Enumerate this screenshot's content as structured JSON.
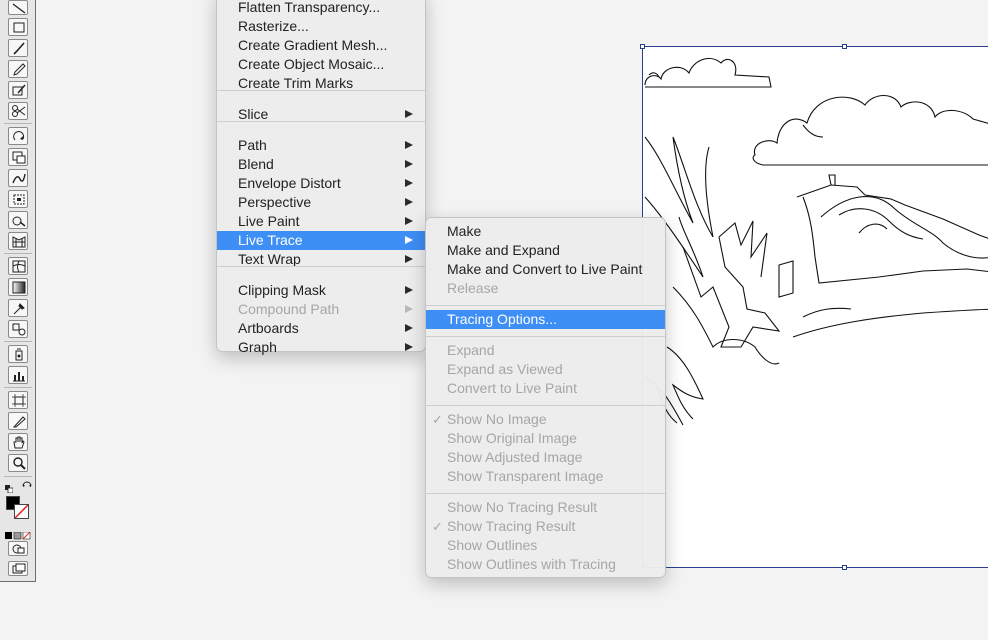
{
  "main_menu": {
    "items": [
      {
        "label": "Flatten Transparency...",
        "enabled": true,
        "submenu": false
      },
      {
        "label": "Rasterize...",
        "enabled": true,
        "submenu": false
      },
      {
        "label": "Create Gradient Mesh...",
        "enabled": true,
        "submenu": false
      },
      {
        "label": "Create Object Mosaic...",
        "enabled": true,
        "submenu": false
      },
      {
        "label": "Create Trim Marks",
        "enabled": true,
        "submenu": false
      },
      {
        "label": "Slice",
        "enabled": true,
        "submenu": true
      },
      {
        "label": "Path",
        "enabled": true,
        "submenu": true
      },
      {
        "label": "Blend",
        "enabled": true,
        "submenu": true
      },
      {
        "label": "Envelope Distort",
        "enabled": true,
        "submenu": true
      },
      {
        "label": "Perspective",
        "enabled": true,
        "submenu": true
      },
      {
        "label": "Live Paint",
        "enabled": true,
        "submenu": true
      },
      {
        "label": "Live Trace",
        "enabled": true,
        "submenu": true,
        "highlighted": true
      },
      {
        "label": "Text Wrap",
        "enabled": true,
        "submenu": true
      },
      {
        "label": "Clipping Mask",
        "enabled": true,
        "submenu": true
      },
      {
        "label": "Compound Path",
        "enabled": false,
        "submenu": true
      },
      {
        "label": "Artboards",
        "enabled": true,
        "submenu": true
      },
      {
        "label": "Graph",
        "enabled": true,
        "submenu": true
      }
    ]
  },
  "live_trace_menu": {
    "items": [
      {
        "label": "Make",
        "enabled": true
      },
      {
        "label": "Make and Expand",
        "enabled": true
      },
      {
        "label": "Make and Convert to Live Paint",
        "enabled": true
      },
      {
        "label": "Release",
        "enabled": false
      },
      {
        "label": "Tracing Options...",
        "enabled": true,
        "highlighted": true
      },
      {
        "label": "Expand",
        "enabled": false
      },
      {
        "label": "Expand as Viewed",
        "enabled": false
      },
      {
        "label": "Convert to Live Paint",
        "enabled": false
      },
      {
        "label": "Show No Image",
        "enabled": false,
        "checked": true
      },
      {
        "label": "Show Original Image",
        "enabled": false
      },
      {
        "label": "Show Adjusted Image",
        "enabled": false
      },
      {
        "label": "Show Transparent Image",
        "enabled": false
      },
      {
        "label": "Show No Tracing Result",
        "enabled": false
      },
      {
        "label": "Show Tracing Result",
        "enabled": false,
        "checked": true
      },
      {
        "label": "Show Outlines",
        "enabled": false
      },
      {
        "label": "Show Outlines with Tracing",
        "enabled": false
      }
    ],
    "check_glyph": "✓"
  },
  "colors": {
    "highlight": "#3d8ef5",
    "artboard_border": "#2b3f8f",
    "disabled_text": "#a6a6a6"
  },
  "toolbar": {
    "tools": [
      "line-segment-tool-icon",
      "rectangle-tool-icon",
      "paintbrush-tool-icon",
      "pencil-tool-icon",
      "blob-brush-tool-icon",
      "scissors-tool-icon",
      "rotate-tool-icon",
      "scale-tool-icon",
      "warp-tool-icon",
      "free-transform-tool-icon",
      "shape-builder-tool-icon",
      "perspective-grid-tool-icon",
      "mesh-tool-icon",
      "gradient-tool-icon",
      "eyedropper-tool-icon",
      "blend-tool-icon",
      "symbol-sprayer-tool-icon",
      "column-graph-tool-icon",
      "artboard-tool-icon",
      "slice-tool-icon",
      "hand-tool-icon",
      "zoom-tool-icon"
    ]
  }
}
